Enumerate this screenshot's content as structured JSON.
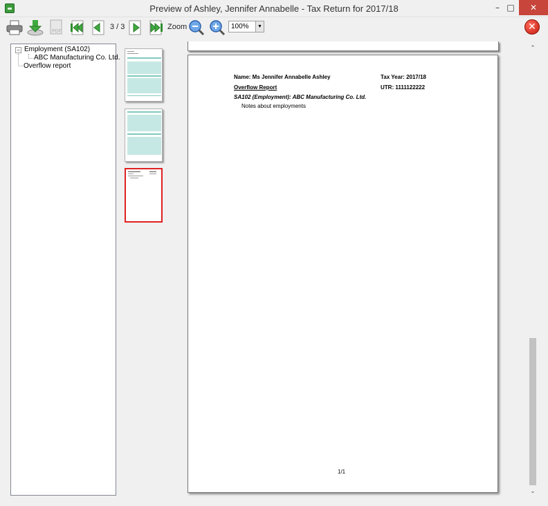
{
  "window": {
    "title": "Preview of Ashley, Jennifer Annabelle - Tax Return for 2017/18",
    "minimize": "–",
    "maximize": "□",
    "close": "✕"
  },
  "toolbar": {
    "page_counter": "3 / 3",
    "zoom_label": "Zoom",
    "zoom_value": "100%",
    "icons": [
      "printer-icon",
      "save-icon",
      "pdf-icon",
      "first-page-icon",
      "previous-page-icon",
      "next-page-icon",
      "last-page-icon",
      "zoom-out-icon",
      "zoom-in-icon",
      "exit-icon"
    ],
    "exit": "✕"
  },
  "tree": {
    "toggle": "−",
    "items": [
      {
        "label": "Employment (SA102)"
      },
      {
        "label": "ABC Manufacturing Co. Ltd."
      },
      {
        "label": "Overflow report"
      }
    ]
  },
  "thumbnails": {
    "count": 3,
    "selected": 3
  },
  "page": {
    "name": "Name: Ms Jennifer Annabelle Ashley",
    "tax_year": "Tax Year: 2017/18",
    "report_title": "Overflow Report",
    "utr": "UTR: 1111122222",
    "section": "SA102 (Employment): ABC Manufacturing Co. Ltd.",
    "notes": "Notes about employments",
    "footer": "1/1"
  },
  "scrollbar": {
    "up": "⌃",
    "down": "⌄"
  },
  "colors": {
    "selected_thumbnail_border": "#e02020",
    "exit_button": "#d9261a",
    "window_close": "#c7453a",
    "form_teal": "#7fc8c0"
  }
}
